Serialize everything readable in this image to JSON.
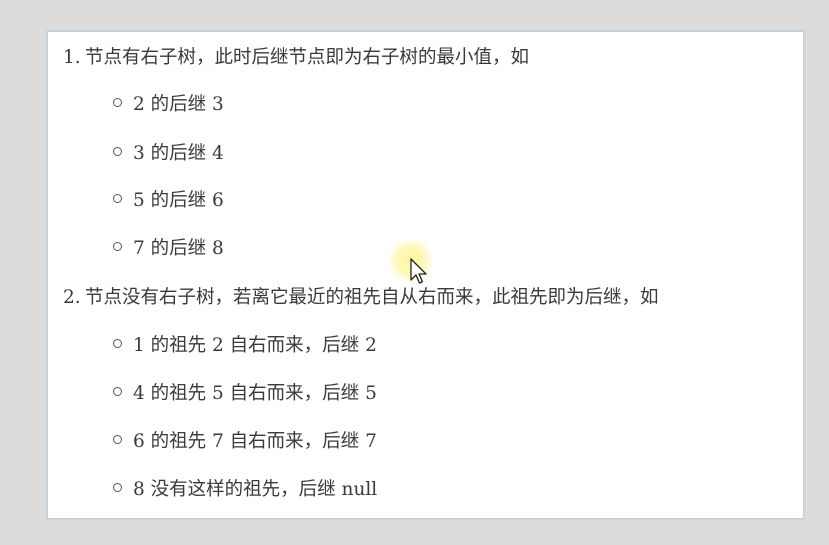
{
  "list": [
    {
      "number": "1.",
      "text": "节点有右子树，此时后继节点即为右子树的最小值，如",
      "subitems": [
        "2 的后继 3",
        "3 的后继 4",
        "5 的后继 6",
        "7 的后继 8"
      ]
    },
    {
      "number": "2.",
      "text": "节点没有右子树，若离它最近的祖先自从右而来，此祖先即为后继，如",
      "subitems": [
        "1 的祖先 2 自右而来，后继 2",
        "4 的祖先 5 自右而来，后继 5",
        "6 的祖先 7 自右而来，后继 7",
        "8 没有这样的祖先，后继 null"
      ]
    }
  ],
  "cursor": {
    "icon": "mouse-pointer-icon",
    "highlight_color": "#fff59a"
  }
}
